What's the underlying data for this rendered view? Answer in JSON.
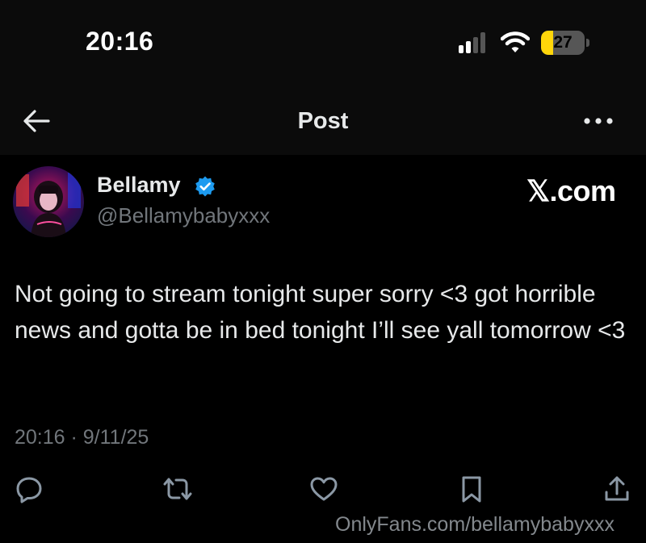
{
  "status_bar": {
    "time": "20:16",
    "battery_level": "27",
    "battery_percent": 0.27,
    "battery_color": "#ffd60a",
    "signal_bars_active": 2,
    "signal_bars_total": 4
  },
  "nav": {
    "title": "Post",
    "back_icon": "arrow-left-icon",
    "more_icon": "more-horizontal-icon"
  },
  "author": {
    "name": "Bellamy",
    "handle": "@Bellamybabyxxx",
    "verified": true,
    "verified_color": "#1d9bf0"
  },
  "brand": {
    "logo_text": "𝕏.com"
  },
  "post": {
    "text": "Not going to stream tonight super sorry <3 got horrible news and gotta be in bed tonight I’ll see yall tomorrow <3",
    "timestamp": "20:16 · 9/11/25"
  },
  "actions": [
    {
      "icon": "reply-icon"
    },
    {
      "icon": "repost-icon"
    },
    {
      "icon": "like-icon"
    },
    {
      "icon": "bookmark-icon"
    },
    {
      "icon": "share-icon"
    }
  ],
  "watermark": "OnlyFans.com/bellamybabyxxx"
}
